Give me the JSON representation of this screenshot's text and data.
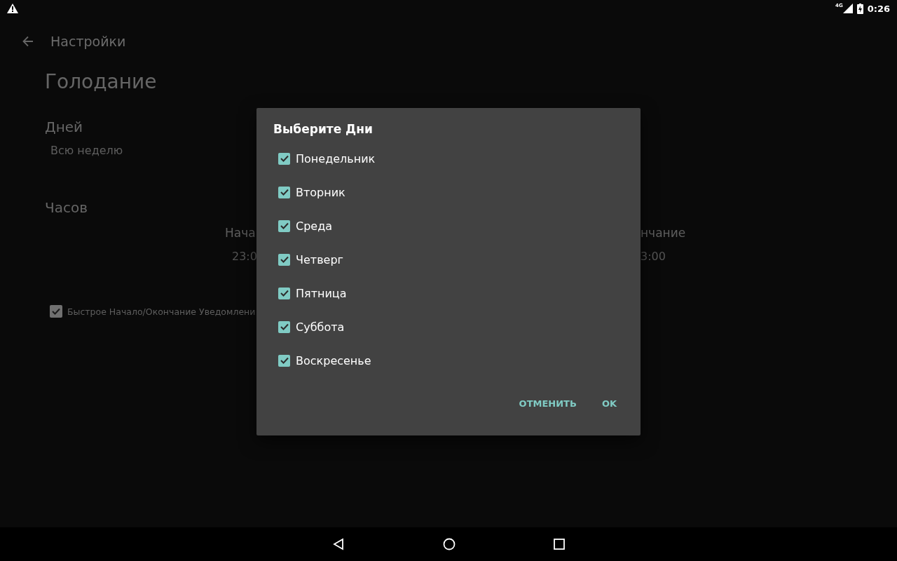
{
  "status_bar": {
    "network": "4G",
    "time": "0:26"
  },
  "toolbar": {
    "title": "Настройки"
  },
  "screen_title": "Голодание",
  "days": {
    "label": "Дней",
    "value": "Всю неделю"
  },
  "hours": {
    "label": "Часов",
    "start_label": "Нача",
    "start_value": "23:0",
    "end_label": "нчание",
    "end_value": "3:00"
  },
  "quick_notification": {
    "label": "Быстрое Начало/Окончание Уведомлени",
    "checked": true
  },
  "dialog": {
    "title": "Выберите Дни",
    "items": [
      {
        "label": "Понедельник",
        "checked": true
      },
      {
        "label": "Вторник",
        "checked": true
      },
      {
        "label": "Среда",
        "checked": true
      },
      {
        "label": "Четверг",
        "checked": true
      },
      {
        "label": "Пятница",
        "checked": true
      },
      {
        "label": "Суббота",
        "checked": true
      },
      {
        "label": "Воскресенье",
        "checked": true
      }
    ],
    "buttons": [
      "ОТМЕНИТЬ",
      "OK"
    ]
  }
}
